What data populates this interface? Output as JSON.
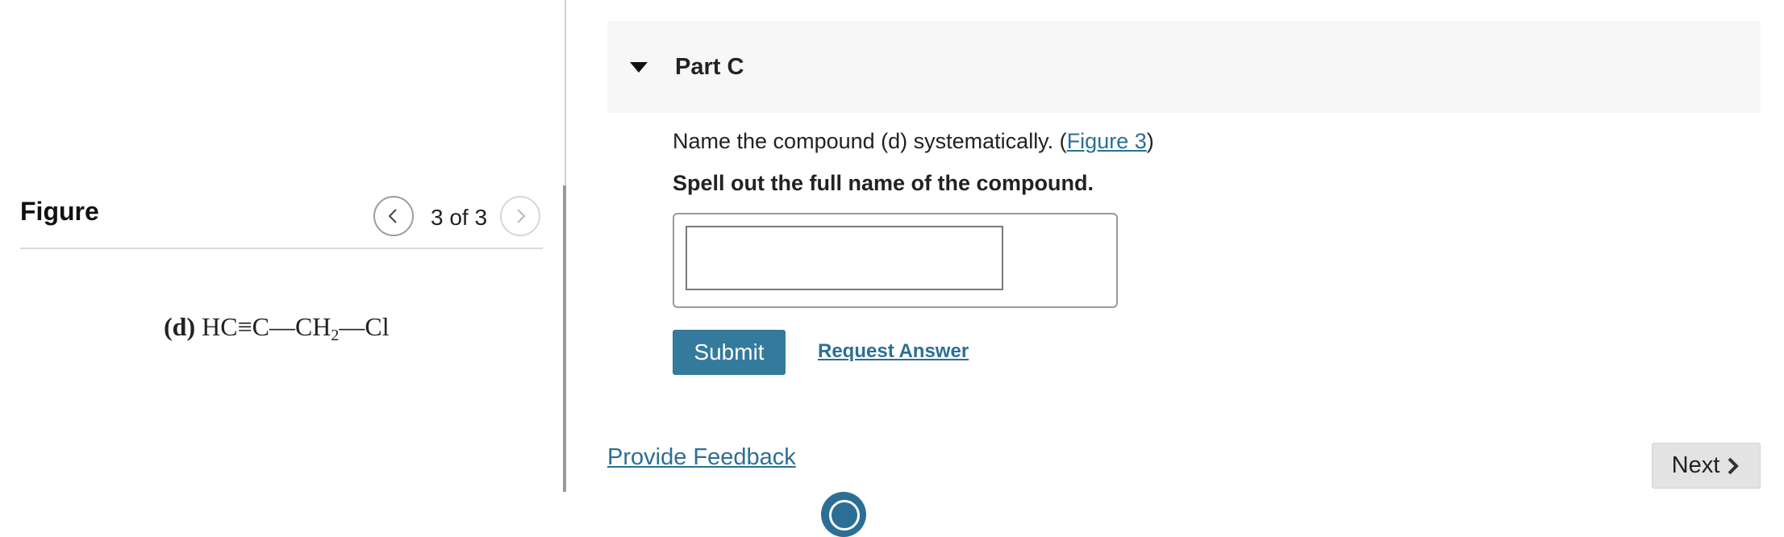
{
  "figure": {
    "title": "Figure",
    "counter": "3 of 3",
    "formula": {
      "label": "(d)",
      "part1": "HC≡C—CH",
      "sub": "2",
      "part2": "—Cl"
    }
  },
  "part": {
    "title": "Part C"
  },
  "question": {
    "text_before": "Name the compound (d) systematically. (",
    "link": "Figure 3",
    "text_after": ")",
    "instruction": "Spell out the full name of the compound."
  },
  "answer": {
    "value": ""
  },
  "buttons": {
    "submit": "Submit",
    "request_answer": "Request Answer",
    "provide_feedback": "Provide Feedback",
    "next": "Next"
  },
  "colors": {
    "accent": "#347a9c",
    "link": "#2b6f95"
  }
}
